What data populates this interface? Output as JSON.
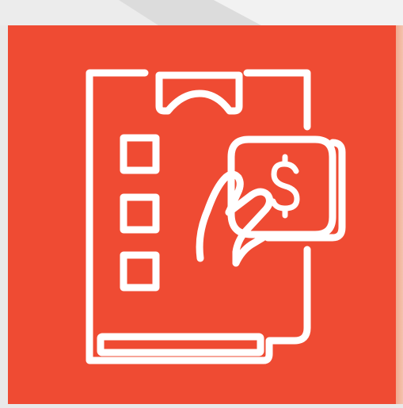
{
  "image": {
    "subject": "",
    "colors": {
      "tile": "#ef4b33",
      "stroke": "#ffffff",
      "background": "#e9e9e9"
    },
    "icons": [
      "clipboard-icon",
      "checkbox-icon",
      "hand-icon",
      "banknote-icon",
      "dollar-sign-icon"
    ]
  }
}
